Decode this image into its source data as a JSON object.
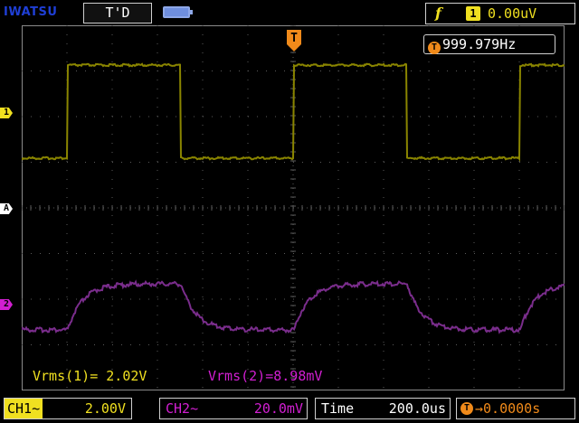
{
  "header": {
    "brand": "IWATSU",
    "state": "T'D",
    "battery_icon": "battery-icon",
    "trigger": {
      "slope_symbol": "f",
      "source": "1",
      "level": "0.00uV"
    }
  },
  "screen": {
    "channel_markers": {
      "ch1": "1",
      "ref": "A",
      "ch2": "2"
    },
    "trigger_position_label": "T",
    "frequency": {
      "icon": "T",
      "value": "999.979Hz"
    },
    "measurements": {
      "ch1": "Vrms(1)= 2.02V",
      "ch2": "Vrms(2)=8.98mV"
    }
  },
  "footer": {
    "ch1": {
      "label": "CH1~",
      "scale": "2.00V"
    },
    "ch2": {
      "label": "CH2~",
      "scale": "20.0mV"
    },
    "timebase": {
      "label": "Time",
      "value": "200.0us"
    },
    "delay": {
      "icon": "T",
      "value": "→0.0000s"
    }
  },
  "colors": {
    "ch1": "#f0e020",
    "ch2": "#d21fd2",
    "trigger": "#f08a1a",
    "brand": "#1f3fd6",
    "ch1_trace": "#8a8500",
    "ch2_trace": "#7a2d8c"
  },
  "waveforms": {
    "ch1": {
      "type": "square",
      "period_us": 1000,
      "amplitude_v_pp": 4.0
    },
    "ch2": {
      "type": "rc-filtered-square",
      "period_us": 1000
    }
  }
}
